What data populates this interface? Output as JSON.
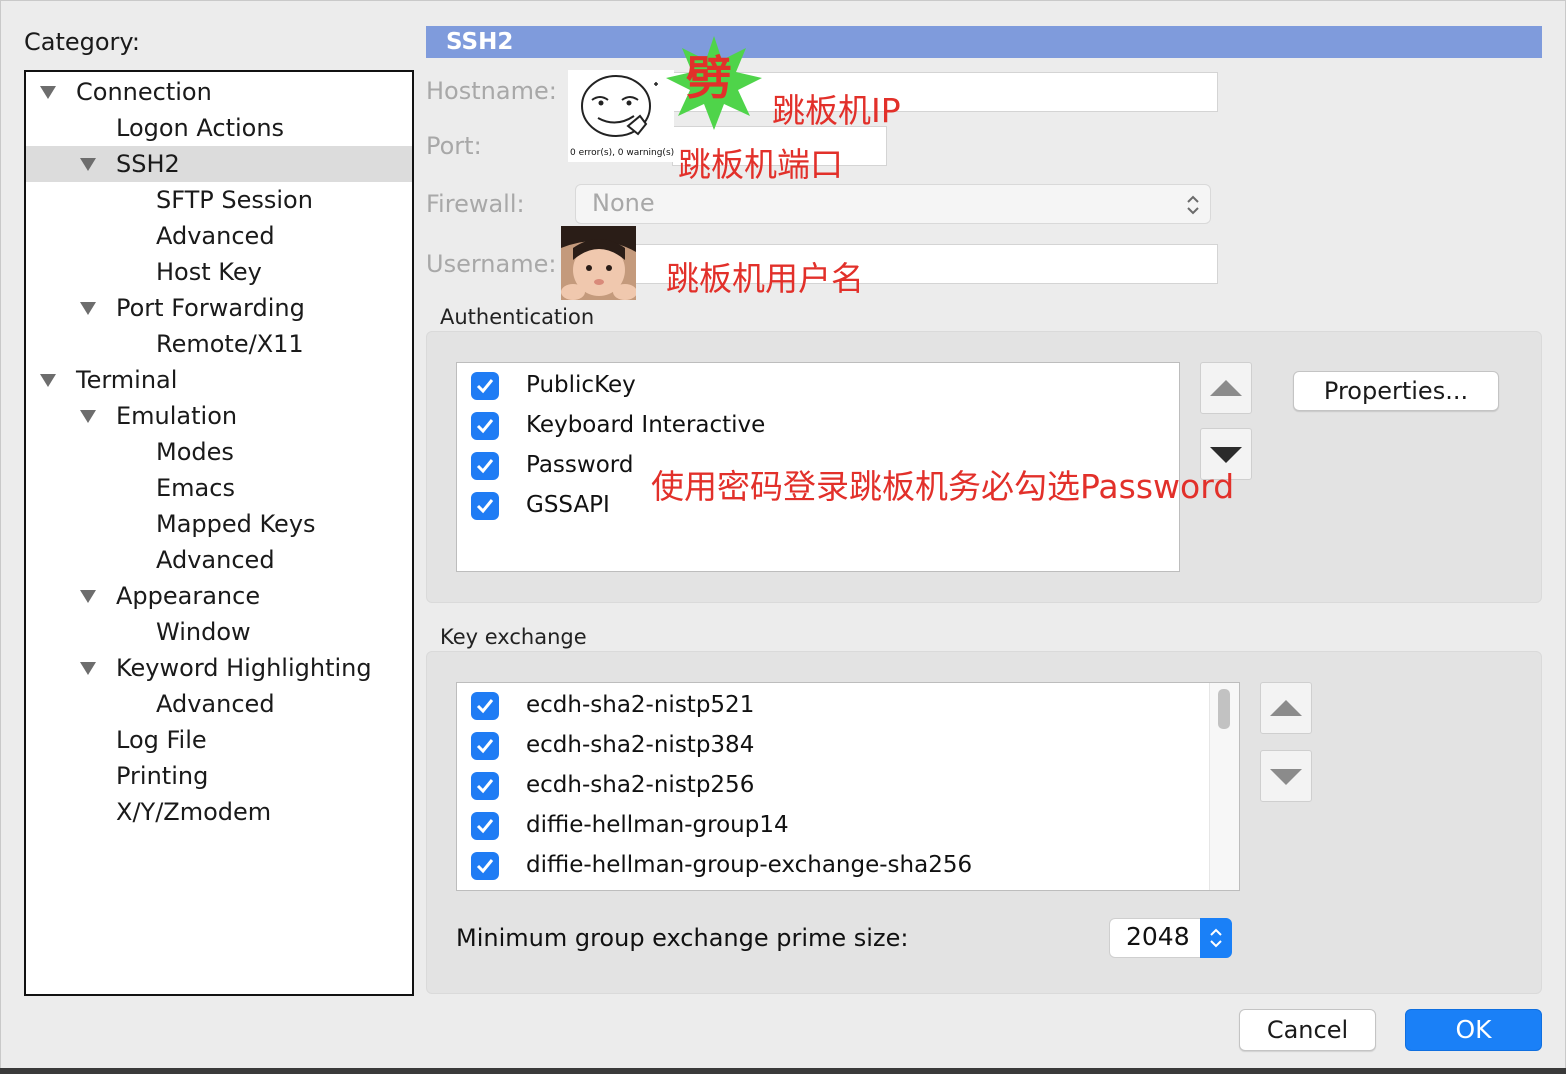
{
  "category": {
    "label": "Category:",
    "items": [
      {
        "label": "Connection",
        "expanded": true
      },
      {
        "label": "Logon Actions"
      },
      {
        "label": "SSH2",
        "expanded": true,
        "selected": true
      },
      {
        "label": "SFTP Session"
      },
      {
        "label": "Advanced"
      },
      {
        "label": "Host Key"
      },
      {
        "label": "Port Forwarding",
        "expanded": true
      },
      {
        "label": "Remote/X11"
      },
      {
        "label": "Terminal",
        "expanded": true
      },
      {
        "label": "Emulation",
        "expanded": true
      },
      {
        "label": "Modes"
      },
      {
        "label": "Emacs"
      },
      {
        "label": "Mapped Keys"
      },
      {
        "label": "Advanced"
      },
      {
        "label": "Appearance",
        "expanded": true
      },
      {
        "label": "Window"
      },
      {
        "label": "Keyword Highlighting",
        "expanded": true
      },
      {
        "label": "Advanced"
      },
      {
        "label": "Log File"
      },
      {
        "label": "Printing"
      },
      {
        "label": "X/Y/Zmodem"
      }
    ]
  },
  "panel": {
    "title": "SSH2",
    "hostname_label": "Hostname:",
    "port_label": "Port:",
    "firewall_label": "Firewall:",
    "firewall_value": "None",
    "username_label": "Username:"
  },
  "sticker": {
    "caption": "0 error(s), 0 warning(s)",
    "stamp": "劈"
  },
  "annotations": {
    "hostname": "跳板机IP",
    "port": "跳板机端口",
    "username": "跳板机用户名",
    "password_note": "使用密码登录跳板机务必勾选Password"
  },
  "authentication": {
    "title": "Authentication",
    "methods": [
      {
        "label": "PublicKey",
        "checked": true
      },
      {
        "label": "Keyboard Interactive",
        "checked": true
      },
      {
        "label": "Password",
        "checked": true
      },
      {
        "label": "GSSAPI",
        "checked": true
      }
    ],
    "properties_label": "Properties..."
  },
  "key_exchange": {
    "title": "Key exchange",
    "algorithms": [
      {
        "label": "ecdh-sha2-nistp521",
        "checked": true
      },
      {
        "label": "ecdh-sha2-nistp384",
        "checked": true
      },
      {
        "label": "ecdh-sha2-nistp256",
        "checked": true
      },
      {
        "label": "diffie-hellman-group14",
        "checked": true
      },
      {
        "label": "diffie-hellman-group-exchange-sha256",
        "checked": true
      }
    ],
    "prime_size_label": "Minimum group exchange prime size:",
    "prime_size_value": "2048"
  },
  "buttons": {
    "cancel": "Cancel",
    "ok": "OK"
  },
  "colors": {
    "accent": "#1a80f7",
    "header_bar": "#7f9bdc",
    "annotation": "#e2302a",
    "stamp_burst": "#4fd44a"
  }
}
